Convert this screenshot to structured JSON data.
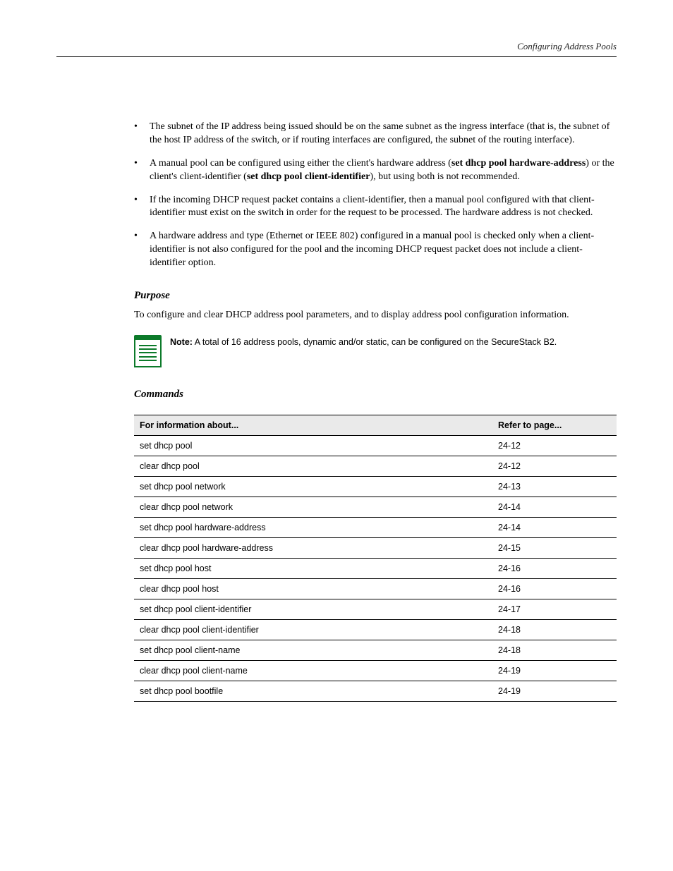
{
  "running_head": "Configuring Address Pools",
  "bullets": [
    {
      "pre": "The subnet of the IP address being issued should be on the same subnet as the ingress interface (that is, the subnet of the host IP address of the switch, or if routing interfaces are configured, the subnet of the routing interface)."
    },
    {
      "pre": "A manual pool can be configured using either the client's hardware address (",
      "b1": "set dhcp pool hardware-address",
      "mid": ") or the client's client-identifier (",
      "b2": "set dhcp pool client-identifier",
      "post": "), but using both is not recommended."
    },
    {
      "pre": "If the incoming DHCP request packet contains a client-identifier, then a manual pool configured with that client-identifier must exist on the switch in order for the request to be processed. The hardware address is not checked."
    },
    {
      "pre": "A hardware address and type (Ethernet or IEEE 802) configured in a manual pool is checked only when a client-identifier is not also configured for the pool and the incoming DHCP request packet does not include a client-identifier option."
    }
  ],
  "purpose_title": "Purpose",
  "purpose_text": "To configure and clear DHCP address pool parameters, and to display address pool configuration information.",
  "note": {
    "label": "Note:",
    "text_pre": " A total of 16 address pools, dynamic and/or static, can be configured on the SecureStack B2",
    "text_post": "."
  },
  "commands_title": "Commands",
  "table": {
    "head_for": "For information about...",
    "head_ref": "Refer to page...",
    "rows": [
      {
        "c": "set dhcp pool",
        "p": "24-12"
      },
      {
        "c": "clear dhcp pool",
        "p": "24-12"
      },
      {
        "c": "set dhcp pool network",
        "p": "24-13"
      },
      {
        "c": "clear dhcp pool network",
        "p": "24-14"
      },
      {
        "c": "set dhcp pool hardware-address",
        "p": "24-14"
      },
      {
        "c": "clear dhcp pool hardware-address",
        "p": "24-15"
      },
      {
        "c": "set dhcp pool host",
        "p": "24-16"
      },
      {
        "c": "clear dhcp pool host",
        "p": "24-16"
      },
      {
        "c": "set dhcp pool client-identifier",
        "p": "24-17"
      },
      {
        "c": "clear dhcp pool client-identifier",
        "p": "24-18"
      },
      {
        "c": "set dhcp pool client-name",
        "p": "24-18"
      },
      {
        "c": "clear dhcp pool client-name",
        "p": "24-19"
      },
      {
        "c": "set dhcp pool bootfile",
        "p": "24-19"
      }
    ]
  }
}
